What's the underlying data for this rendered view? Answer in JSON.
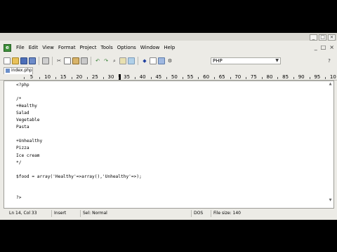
{
  "menu": [
    "File",
    "Edit",
    "View",
    "Format",
    "Project",
    "Tools",
    "Options",
    "Window",
    "Help"
  ],
  "window_controls": [
    "_",
    "□",
    "×"
  ],
  "mdi_controls": [
    "_",
    "□",
    "×"
  ],
  "toolbar": {
    "language": "PHP",
    "language_arrow": "▼",
    "buttons": [
      "new-file",
      "open-folder",
      "save",
      "save-all",
      "print",
      "cut",
      "copy",
      "paste",
      "paste-special",
      "undo",
      "redo",
      "find",
      "find-next",
      "replace",
      "bookmark",
      "comment",
      "preview",
      "settings"
    ]
  },
  "tab": {
    "label": "index.php"
  },
  "ruler": {
    "numbers": [
      "5",
      "10",
      "15",
      "20",
      "25",
      "30",
      "35",
      "40",
      "45",
      "50",
      "55",
      "60",
      "65",
      "70",
      "75",
      "80",
      "85",
      "90",
      "95",
      "10"
    ]
  },
  "editor": {
    "lines": [
      "<?php",
      "",
      "/*",
      "+Healthy",
      "Salad",
      "Vegetable",
      "Pasta",
      "",
      "+Unhealthy",
      "Pizza",
      "Ice cream",
      "*/",
      "",
      "$food = array('Healthy'=>array(),'Unhealthy'=>);",
      "",
      "",
      "?>"
    ]
  },
  "status": {
    "position": "Ln 14, Col 33",
    "mode": "Insert",
    "sel": "Sel: Normal",
    "encoding": "DOS",
    "filesize": "File size: 140"
  },
  "colors": {
    "chrome": "#ecebe6",
    "editor_bg": "#ffffff",
    "letterbox": "#000000"
  }
}
